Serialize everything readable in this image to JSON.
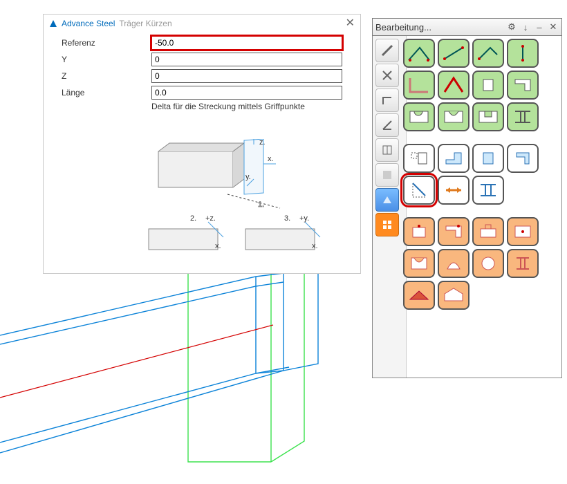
{
  "dialog": {
    "app_name": "Advance Steel",
    "subtitle": "Träger Kürzen",
    "close_glyph": "✕",
    "rows": {
      "referenz": {
        "label": "Referenz",
        "value": "-50.0"
      },
      "y": {
        "label": "Y",
        "value": "0"
      },
      "z": {
        "label": "Z",
        "value": "0"
      },
      "laenge": {
        "label": "Länge",
        "value": "0.0"
      }
    },
    "helper": "Delta für die Streckung mittels Griffpunkte"
  },
  "palette": {
    "title": "Bearbeitung...",
    "buttons": {
      "gear": "⚙",
      "pin": "↓",
      "min": "–",
      "close": "✕"
    }
  },
  "icons": {
    "sidebar": [
      "pencil",
      "wrench",
      "square",
      "angle",
      "grid",
      "fade",
      "blue",
      "orange"
    ]
  }
}
